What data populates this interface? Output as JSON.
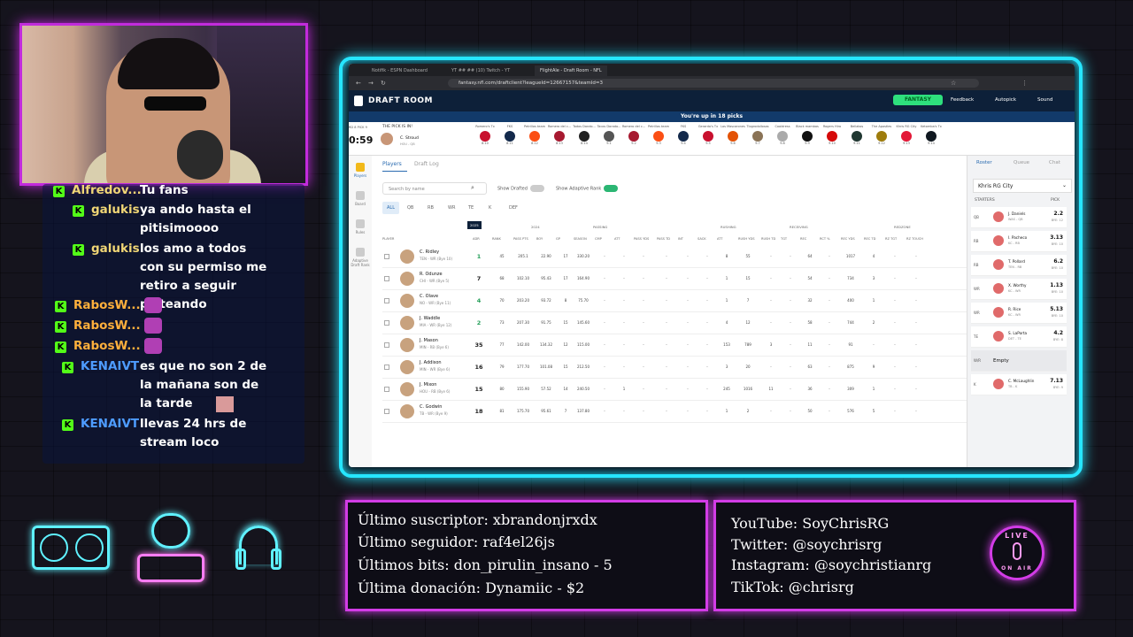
{
  "chat": [
    {
      "user": "Alfredov...",
      "text": "Tu fans",
      "style": "user-g"
    },
    {
      "user": "galukis",
      "text": "ya ando hasta el pitisimoooo",
      "style": "user-g"
    },
    {
      "user": "galukis",
      "text": "los amo a todos con su permiso me retiro a seguir pisteando",
      "style": "user-g"
    },
    {
      "user": "RabosW...",
      "text": "",
      "style": "user-r"
    },
    {
      "user": "RabosW...",
      "text": "",
      "style": "user-r"
    },
    {
      "user": "RabosW...",
      "text": "",
      "style": "user-r"
    },
    {
      "user": "KENAIVT",
      "text": "es que no son 2 de la mañana son de la tarde",
      "style": "user-b"
    },
    {
      "user": "KENAIVT",
      "text": "llevas 24 hrs de stream loco",
      "style": "user-b"
    }
  ],
  "chat_badge": "K",
  "browser": {
    "tabs": [
      "Notifik - ESPN Dashboard",
      "YT ## ## (10) Twitch - YT",
      "FlightAle - Draft Room - NFL"
    ],
    "url": "fantasy.nfl.com/draftclient?leagueId=12667157&teamId=3",
    "app_title": "DRAFT ROOM",
    "fantasy_label": "FANTASY",
    "feedback": "Feedback",
    "autopick": "Autopick",
    "sound": "Sound",
    "banner": "You're up in 18 picks",
    "clock": "0:59",
    "pick_label": "THE PICK IS IN!",
    "pick_round": "RD 8 PICK 9",
    "pick_player": "C. Stroud",
    "pick_team": "HOU - QB",
    "pick_cells": [
      {
        "team": "Romero's Tx",
        "pick": "8.10",
        "color": "#c8102e"
      },
      {
        "team": "FKS",
        "pick": "8.11",
        "color": "#13294b"
      },
      {
        "team": "Petrillos team",
        "pick": "8.12",
        "color": "#fb4f14"
      },
      {
        "team": "Romero del c...",
        "pick": "8.13",
        "color": "#a71930"
      },
      {
        "team": "Todos Dando...",
        "pick": "8.14",
        "color": "#222"
      },
      {
        "team": "Tacos Dorado...",
        "pick": "9.1",
        "color": "#555"
      },
      {
        "team": "Romero del c...",
        "pick": "9.2",
        "color": "#a71930"
      },
      {
        "team": "Petrillos team",
        "pick": "9.3",
        "color": "#fb4f14"
      },
      {
        "team": "FKS",
        "pick": "9.4",
        "color": "#13294b"
      },
      {
        "team": "Gerardo's Tx",
        "pick": "9.5",
        "color": "#c8102e"
      },
      {
        "team": "Los Mascarones",
        "pick": "9.6",
        "color": "#e35205"
      },
      {
        "team": "Tlogrodollosas",
        "pick": "9.7",
        "color": "#8a7356"
      },
      {
        "team": "Cooldress",
        "pick": "9.8",
        "color": "#aaa"
      },
      {
        "team": "Black mambas",
        "pick": "9.9",
        "color": "#111"
      },
      {
        "team": "Rogers Hiro",
        "pick": "9.10",
        "color": "#d50a0a"
      },
      {
        "team": "Bellakos",
        "pick": "9.11",
        "color": "#203731"
      },
      {
        "team": "The Apostles",
        "pick": "9.12",
        "color": "#9e7c0c"
      },
      {
        "team": "Khris RG City",
        "pick": "9.13",
        "color": "#e31837"
      },
      {
        "team": "Ketomba's Tx",
        "pick": "9.14",
        "color": "#101820"
      }
    ],
    "sidebar": [
      "Players",
      "Board",
      "Rules",
      "Adaptive Draft Rank"
    ],
    "player_tabs": [
      "Players",
      "Draft Log"
    ],
    "search_placeholder": "Search by name",
    "show_drafted": "Show Drafted",
    "show_adaptive": "Show Adaptive Rank",
    "positions": [
      "ALL",
      "QB",
      "RB",
      "WR",
      "TE",
      "K",
      "DEF"
    ],
    "groups": [
      "2025",
      "2024",
      "PASSING",
      "RUSHING",
      "RECEIVING",
      "REDZONE"
    ],
    "columns": [
      "PLAYER",
      "ADR",
      "RANK",
      "PASS PTS",
      "BOY",
      "GP",
      "SEASON",
      "CMP",
      "ATT",
      "PASS YDS",
      "PASS TD",
      "INT",
      "SACK",
      "ATT",
      "RUSH YDS",
      "RUSH TD",
      "TGT",
      "REC",
      "RCT %",
      "REC YDS",
      "REC TD",
      "RZ TGT",
      "RZ TOUCH"
    ],
    "players": [
      {
        "name": "C. Ridley",
        "team": "TEN - WR (Bye 10)",
        "rank": "1",
        "green": true,
        "c": [
          "45",
          "205.1",
          "22.90",
          "17",
          "330.20",
          "-",
          "-",
          "-",
          "-",
          "-",
          "-",
          "8",
          "55",
          "-",
          "-",
          "64",
          "-",
          "1017",
          "4",
          "-",
          "-"
        ]
      },
      {
        "name": "R. Odunze",
        "team": "CHI - WR (Bye 5)",
        "rank": "7",
        "green": false,
        "c": [
          "68",
          "102.10",
          "95.43",
          "17",
          "164.90",
          "-",
          "-",
          "-",
          "-",
          "-",
          "-",
          "1",
          "15",
          "-",
          "-",
          "54",
          "-",
          "734",
          "3",
          "-",
          "-"
        ]
      },
      {
        "name": "C. Olave",
        "team": "NO - WR (Bye 11)",
        "rank": "4",
        "green": true,
        "c": [
          "70",
          "203.20",
          "93.72",
          "8",
          "75.70",
          "-",
          "-",
          "-",
          "-",
          "-",
          "-",
          "1",
          "7",
          "-",
          "-",
          "32",
          "-",
          "400",
          "1",
          "-",
          "-"
        ]
      },
      {
        "name": "J. Waddle",
        "team": "MIA - WR (Bye 12)",
        "rank": "2",
        "green": true,
        "c": [
          "73",
          "207.30",
          "91.75",
          "15",
          "145.60",
          "-",
          "-",
          "-",
          "-",
          "-",
          "-",
          "4",
          "12",
          "-",
          "-",
          "58",
          "-",
          "744",
          "2",
          "-",
          "-"
        ]
      },
      {
        "name": "J. Mason",
        "team": "MIN - RB (Bye 6)",
        "rank": "35",
        "green": false,
        "c": [
          "77",
          "142.00",
          "134.32",
          "12",
          "115.00",
          "-",
          "-",
          "-",
          "-",
          "-",
          "-",
          "153",
          "789",
          "3",
          "-",
          "11",
          "-",
          "91",
          "-",
          "-",
          "-"
        ]
      },
      {
        "name": "J. Addison",
        "team": "MIN - WR (Bye 6)",
        "rank": "16",
        "green": false,
        "c": [
          "79",
          "177.70",
          "101.08",
          "15",
          "212.50",
          "-",
          "-",
          "-",
          "-",
          "-",
          "-",
          "3",
          "20",
          "-",
          "-",
          "63",
          "-",
          "875",
          "9",
          "-",
          "-"
        ]
      },
      {
        "name": "J. Mixon",
        "team": "HOU - RB (Bye 6)",
        "rank": "15",
        "green": false,
        "c": [
          "80",
          "155.90",
          "57.52",
          "14",
          "240.50",
          "-",
          "1",
          "-",
          "-",
          "-",
          "-",
          "245",
          "1016",
          "11",
          "-",
          "36",
          "-",
          "309",
          "1",
          "-",
          "-"
        ]
      },
      {
        "name": "C. Godwin",
        "team": "TB - WR (Bye 9)",
        "rank": "18",
        "green": false,
        "c": [
          "81",
          "175.70",
          "95.61",
          "7",
          "137.80",
          "-",
          "-",
          "-",
          "-",
          "-",
          "-",
          "1",
          "2",
          "-",
          "-",
          "50",
          "-",
          "576",
          "5",
          "-",
          "-"
        ]
      }
    ],
    "right_tabs": [
      "Roster",
      "Queue",
      "Chat"
    ],
    "team_name": "Khris RG City",
    "starters_label": "STARTERS",
    "pick_col": "PICK",
    "roster": [
      {
        "pos": "QB",
        "name": "J. Daniels",
        "team": "WAS - QB",
        "pick": "2.2",
        "bye": "BYE: 12"
      },
      {
        "pos": "RB",
        "name": "I. Pacheco",
        "team": "KC - RB",
        "pick": "3.13",
        "bye": "BYE: 10"
      },
      {
        "pos": "RB",
        "name": "T. Pollard",
        "team": "TEN - RB",
        "pick": "6.2",
        "bye": "BYE: 10"
      },
      {
        "pos": "WR",
        "name": "X. Worthy",
        "team": "KC - WR",
        "pick": "1.13",
        "bye": "BYE: 10"
      },
      {
        "pos": "WR",
        "name": "R. Rice",
        "team": "KC - WR",
        "pick": "5.13",
        "bye": "BYE: 10"
      },
      {
        "pos": "TE",
        "name": "S. LaPorta",
        "team": "DET - TE",
        "pick": "4.2",
        "bye": "BYE: 8"
      },
      {
        "pos": "W/R",
        "name": "Empty",
        "team": "",
        "pick": "",
        "bye": ""
      },
      {
        "pos": "K",
        "name": "C. McLaughlin",
        "team": "TB - K",
        "pick": "7.13",
        "bye": "BYE: 9"
      }
    ]
  },
  "stats_box": [
    "Último suscriptor: xbrandonjrxdx",
    "Último seguidor: raf4el26js",
    "Últimos bits: don_pirulin_insano - 5",
    "Última donación: Dynamiic - $2"
  ],
  "social_box": [
    "YouTube: SoyChrisRG",
    "Twitter: @soychrisrg",
    "Instagram: @soychristianrg",
    "TikTok: @chrisrg"
  ],
  "live_badge": {
    "top": "LIVE",
    "bottom": "ON AIR"
  },
  "colors": {
    "neon_cyan": "#26e6ff",
    "neon_magenta": "#d23ce6",
    "kick_green": "#53fc18",
    "nfl_navy": "#0d2039",
    "fantasy_green": "#2ee07d"
  }
}
